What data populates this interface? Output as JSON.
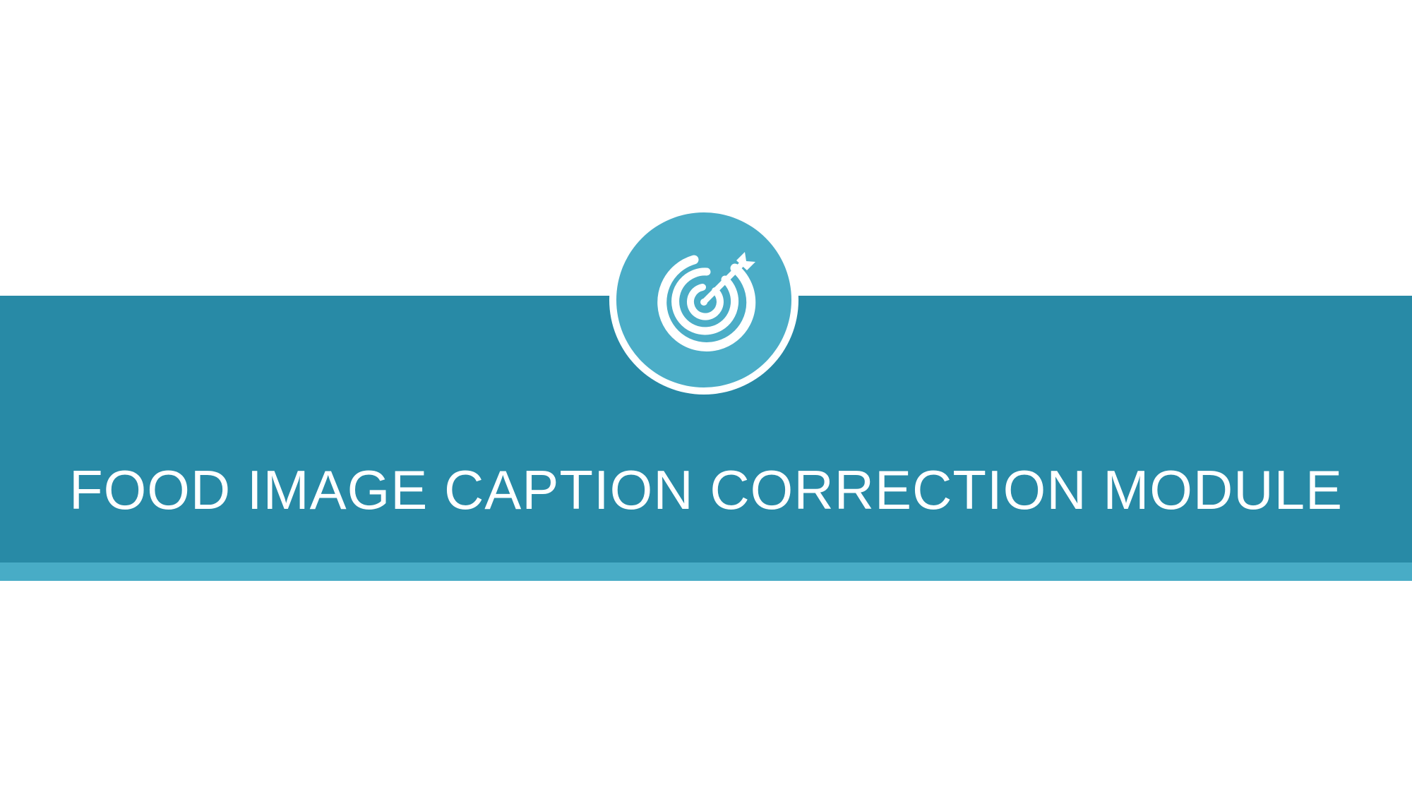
{
  "slide": {
    "title": "FOOD IMAGE CAPTION CORRECTION MODULE",
    "icon": "target-with-arrow-icon"
  },
  "colors": {
    "background": "#ffffff",
    "band": "#288aa6",
    "stripe": "#48acc6",
    "badge": "#4badc7",
    "foreground": "#ffffff"
  }
}
